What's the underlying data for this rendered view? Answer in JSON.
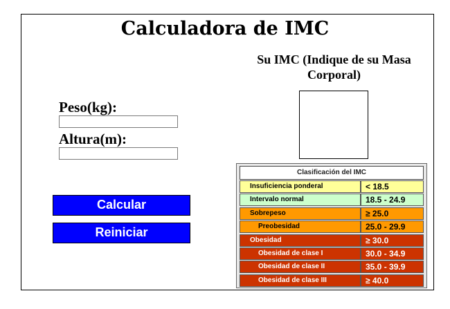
{
  "title": "Calculadora de IMC",
  "result_heading": "Su IMC (Indique de su Masa Corporal)",
  "form": {
    "peso_label": "Peso(kg):",
    "peso_value": "",
    "altura_label": "Altura(m):",
    "altura_value": ""
  },
  "buttons": {
    "calcular": "Calcular",
    "reiniciar": "Reiniciar"
  },
  "bmi_table": {
    "header": "Clasificación del IMC",
    "rows": [
      {
        "category": "Insuficiencia ponderal",
        "range": "< 18.5",
        "bg": "#ffff99",
        "text": "#000000",
        "indent": false
      },
      {
        "category": "Intervalo normal",
        "range": "18.5 - 24.9",
        "bg": "#ccffcc",
        "text": "#000000",
        "indent": false
      },
      {
        "category": "Sobrepeso",
        "range": "≥ 25.0",
        "bg": "#ff9900",
        "text": "#000000",
        "indent": false
      },
      {
        "category": "Preobesidad",
        "range": "25.0 - 29.9",
        "bg": "#ff9900",
        "text": "#000000",
        "indent": true
      },
      {
        "category": "Obesidad",
        "range": "≥ 30.0",
        "bg": "#cc3300",
        "text": "#ffffff",
        "indent": false
      },
      {
        "category": "Obesidad de clase I",
        "range": "30.0 - 34.9",
        "bg": "#cc3300",
        "text": "#ffffff",
        "indent": true
      },
      {
        "category": "Obesidad de clase II",
        "range": "35.0 - 39.9",
        "bg": "#cc3300",
        "text": "#ffffff",
        "indent": true
      },
      {
        "category": "Obesidad de clase III",
        "range": "≥ 40.0",
        "bg": "#cc3300",
        "text": "#ffffff",
        "indent": true
      }
    ]
  },
  "colors": {
    "button_bg": "#0000ff",
    "button_text": "#ffffff"
  }
}
